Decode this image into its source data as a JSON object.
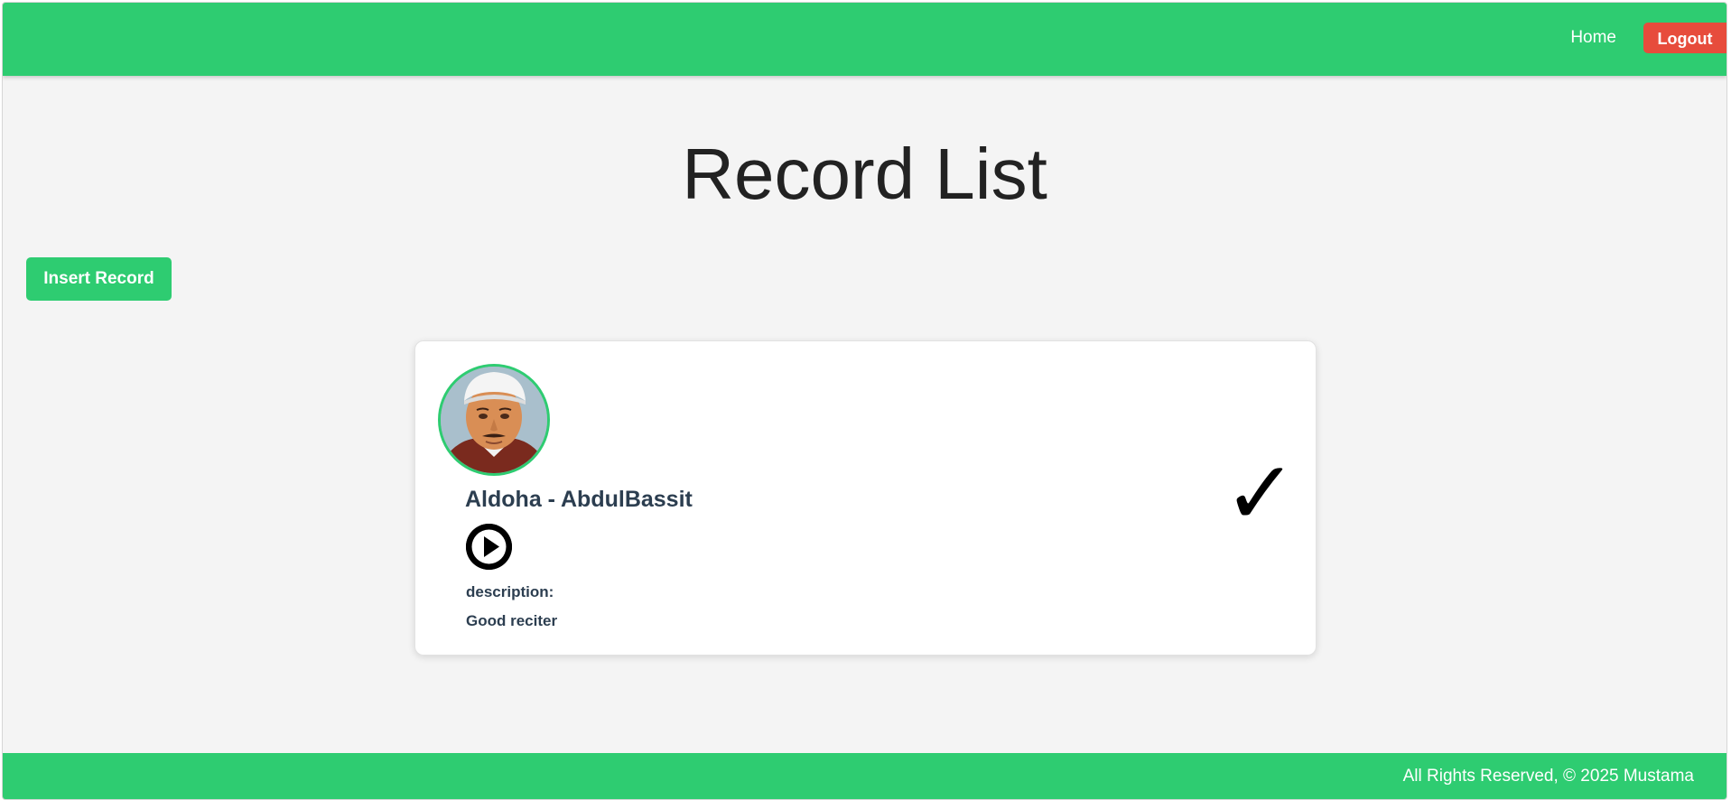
{
  "navbar": {
    "home_label": "Home",
    "logout_label": "Logout"
  },
  "page": {
    "title": "Record List",
    "insert_label": "Insert Record"
  },
  "records": [
    {
      "title": "Aldoha - AbdulBassit",
      "description_label": "description:",
      "description": "Good reciter",
      "status_icon": "check-icon",
      "status_glyph": "✓"
    }
  ],
  "footer": {
    "text": "All Rights Reserved, © 2025 Mustama"
  },
  "colors": {
    "primary": "#2ecc71",
    "danger": "#e74c3c",
    "text_dark": "#2c3e50",
    "background": "#f4f4f4"
  }
}
